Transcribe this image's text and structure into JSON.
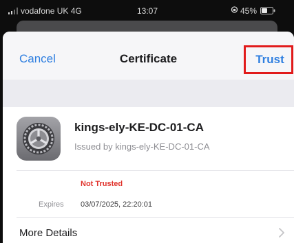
{
  "status_bar": {
    "carrier": "vodafone UK  4G",
    "time": "13:07",
    "battery_percent": "45%"
  },
  "nav": {
    "cancel_label": "Cancel",
    "title": "Certificate",
    "trust_label": "Trust"
  },
  "certificate": {
    "icon": "settings-gear-icon",
    "name": "kings-ely-KE-DC-01-CA",
    "issuer": "Issued by kings-ely-KE-DC-01-CA",
    "status": "Not Trusted",
    "expires_label": "Expires",
    "expires_value": "03/07/2025, 22:20:01"
  },
  "more_details_label": "More Details",
  "colors": {
    "accent": "#2f7fe0",
    "highlight_border": "#e11b1b",
    "not_trusted": "#e0322b"
  }
}
